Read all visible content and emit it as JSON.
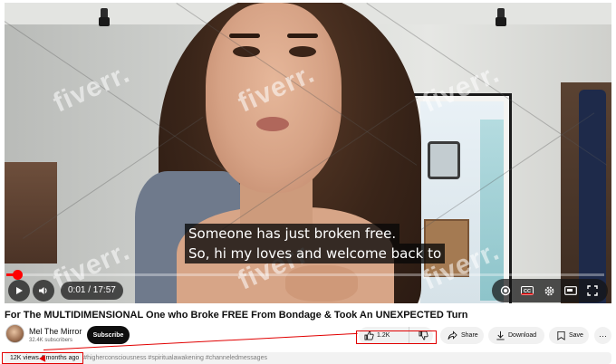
{
  "player": {
    "captions": [
      "Someone has just broken free.",
      "So, hi my loves and welcome back to"
    ],
    "watermark": "fiverr.",
    "progress_fraction": 0.018,
    "time": "0:01 / 17:57"
  },
  "video": {
    "title": "For The MULTIDIMENSIONAL One who Broke FREE From Bondage & Took An UNEXPECTED Turn"
  },
  "channel": {
    "name": "Mel The Mirror",
    "subscribers": "32.4K subscribers",
    "subscribe_label": "Subscribe"
  },
  "actions": {
    "likes": "1.2K",
    "share": "Share",
    "download": "Download",
    "save": "Save",
    "more": "···"
  },
  "description": {
    "stats": "12K views  4 months ago",
    "tags": "#higherconsciousness #spiritualawakening #channeledmessages"
  },
  "colors": {
    "accent": "#ff0000",
    "annotation": "#e10000"
  }
}
